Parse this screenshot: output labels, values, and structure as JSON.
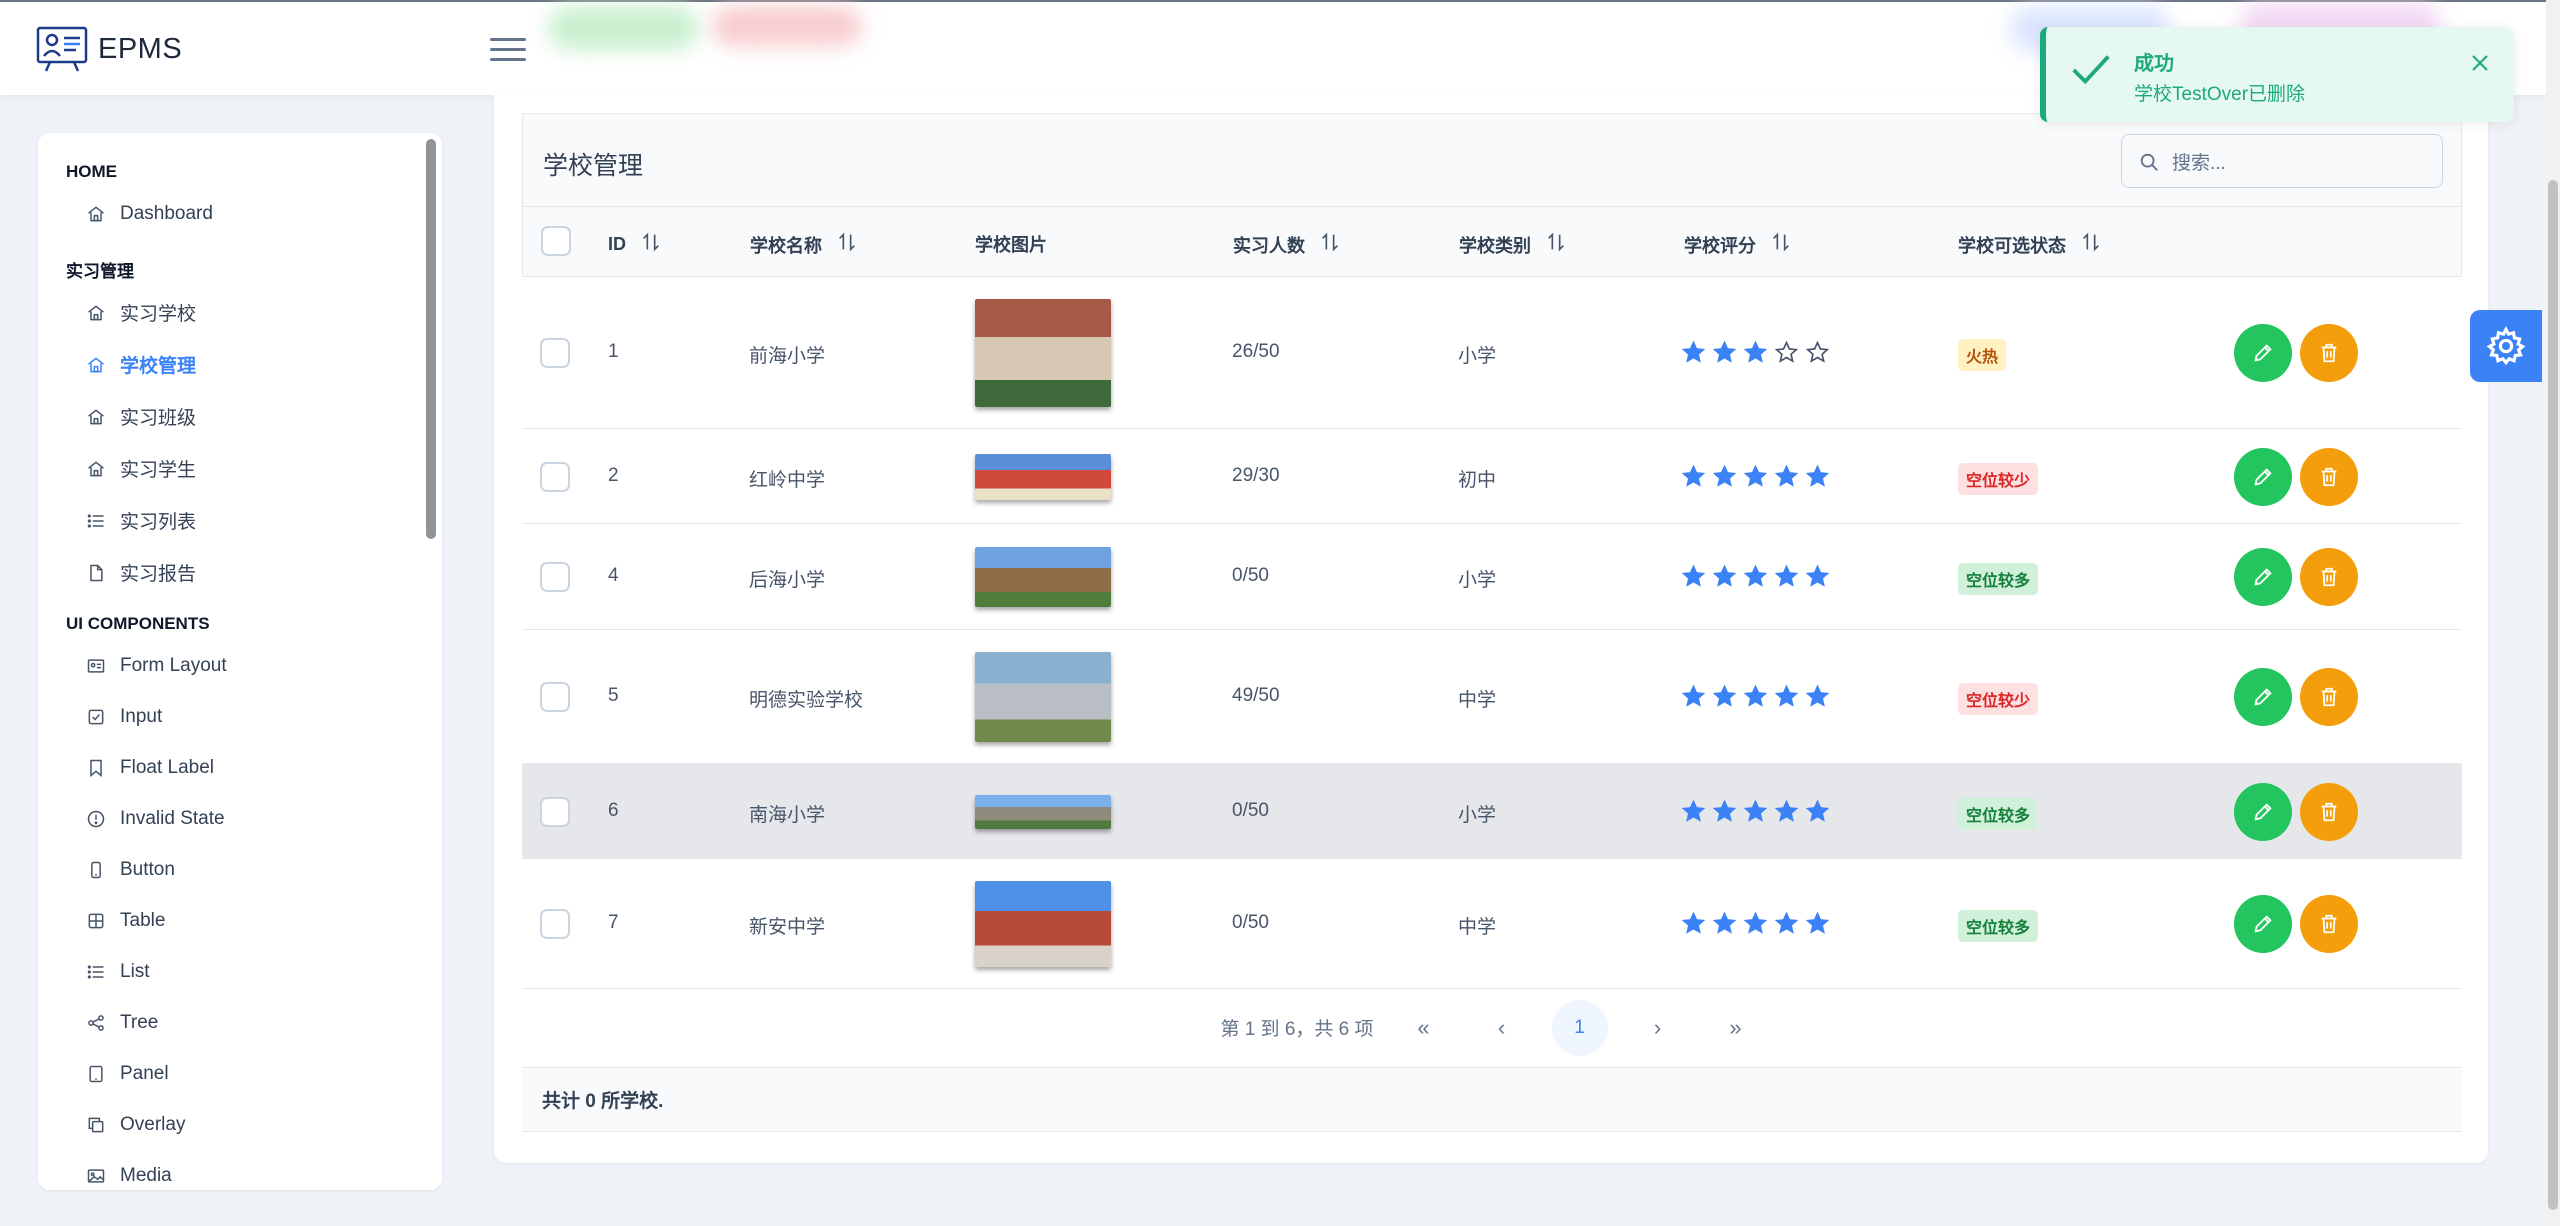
{
  "app": {
    "title": "EPMS"
  },
  "sidebar": {
    "sections": [
      {
        "label": "HOME",
        "items": [
          {
            "label": "Dashboard",
            "icon": "home-icon"
          }
        ]
      },
      {
        "label": "实习管理",
        "items": [
          {
            "label": "实习学校",
            "icon": "home-icon"
          },
          {
            "label": "学校管理",
            "icon": "home-icon",
            "active": true
          },
          {
            "label": "实习班级",
            "icon": "home-icon"
          },
          {
            "label": "实习学生",
            "icon": "home-icon"
          },
          {
            "label": "实习列表",
            "icon": "list-icon"
          },
          {
            "label": "实习报告",
            "icon": "file-icon"
          }
        ]
      },
      {
        "label": "UI COMPONENTS",
        "items": [
          {
            "label": "Form Layout",
            "icon": "id-card-icon"
          },
          {
            "label": "Input",
            "icon": "check-square-icon"
          },
          {
            "label": "Float Label",
            "icon": "bookmark-icon"
          },
          {
            "label": "Invalid State",
            "icon": "exclamation-circle-icon"
          },
          {
            "label": "Button",
            "icon": "mobile-icon"
          },
          {
            "label": "Table",
            "icon": "table-icon"
          },
          {
            "label": "List",
            "icon": "list-icon"
          },
          {
            "label": "Tree",
            "icon": "share-icon"
          },
          {
            "label": "Panel",
            "icon": "tablet-icon"
          },
          {
            "label": "Overlay",
            "icon": "clone-icon"
          },
          {
            "label": "Media",
            "icon": "image-icon"
          }
        ]
      }
    ]
  },
  "table": {
    "title": "学校管理",
    "search_placeholder": "搜索...",
    "columns": [
      "ID",
      "学校名称",
      "学校图片",
      "实习人数",
      "学校类别",
      "学校评分",
      "学校可选状态"
    ],
    "rows": [
      {
        "id": "1",
        "name": "前海小学",
        "count": "26/50",
        "type": "小学",
        "rating": 3,
        "status": "火热",
        "status_kind": "hot"
      },
      {
        "id": "2",
        "name": "红岭中学",
        "count": "29/30",
        "type": "初中",
        "rating": 5,
        "status": "空位较少",
        "status_kind": "few"
      },
      {
        "id": "4",
        "name": "后海小学",
        "count": "0/50",
        "type": "小学",
        "rating": 5,
        "status": "空位较多",
        "status_kind": "many"
      },
      {
        "id": "5",
        "name": "明德实验学校",
        "count": "49/50",
        "type": "中学",
        "rating": 5,
        "status": "空位较少",
        "status_kind": "few"
      },
      {
        "id": "6",
        "name": "南海小学",
        "count": "0/50",
        "type": "小学",
        "rating": 5,
        "status": "空位较多",
        "status_kind": "many"
      },
      {
        "id": "7",
        "name": "新安中学",
        "count": "0/50",
        "type": "中学",
        "rating": 5,
        "status": "空位较多",
        "status_kind": "many"
      }
    ],
    "pager_text": "第 1 到 6，共 6 项",
    "current_page": "1",
    "footer": "共计 0 所学校."
  },
  "toast": {
    "title": "成功",
    "message": "学校TestOver已删除"
  },
  "colors": {
    "accent": "#3b82f6",
    "success": "#22c55e",
    "warning": "#f59e0b",
    "toast": "#1ea97c"
  }
}
